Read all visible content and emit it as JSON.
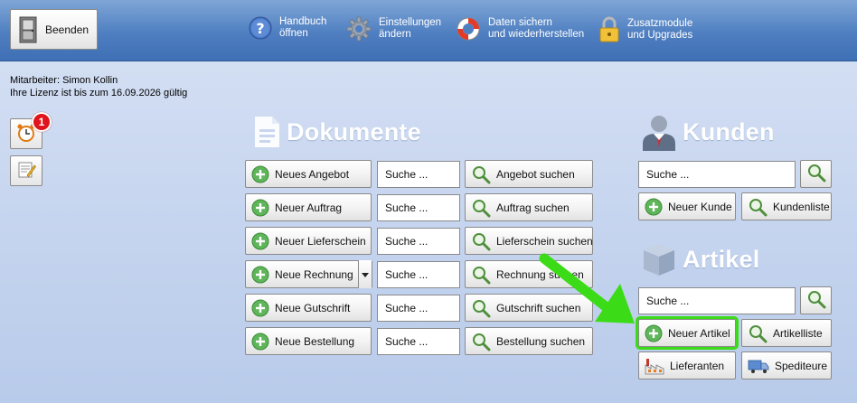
{
  "toolbar": {
    "quit_label": "Beenden",
    "items": [
      {
        "line1": "Handbuch",
        "line2": "öffnen",
        "icon": "help-icon"
      },
      {
        "line1": "Einstellungen",
        "line2": "ändern",
        "icon": "gear-icon"
      },
      {
        "line1": "Daten sichern",
        "line2": "und wiederherstellen",
        "icon": "lifebuoy-icon"
      },
      {
        "line1": "Zusatzmodule",
        "line2": "und Upgrades",
        "icon": "lock-icon"
      }
    ]
  },
  "info": {
    "employee": "Mitarbeiter: Simon Kollin",
    "license": "Ihre Lizenz ist bis zum 16.09.2026 gültig"
  },
  "side": {
    "reminder_count": "1"
  },
  "dokumente": {
    "title": "Dokumente",
    "rows": [
      {
        "new_label": "Neues Angebot",
        "search_value": "Suche ...",
        "search_label": "Angebot suchen"
      },
      {
        "new_label": "Neuer Auftrag",
        "search_value": "Suche ...",
        "search_label": "Auftrag suchen"
      },
      {
        "new_label": "Neuer Lieferschein",
        "search_value": "Suche ...",
        "search_label": "Lieferschein suchen"
      },
      {
        "new_label": "Neue Rechnung",
        "search_value": "Suche ...",
        "search_label": "Rechnung suchen"
      },
      {
        "new_label": "Neue Gutschrift",
        "search_value": "Suche ...",
        "search_label": "Gutschrift suchen"
      },
      {
        "new_label": "Neue Bestellung",
        "search_value": "Suche ...",
        "search_label": "Bestellung suchen"
      }
    ]
  },
  "kunden": {
    "title": "Kunden",
    "search_value": "Suche ...",
    "new_label": "Neuer Kunde",
    "list_label": "Kundenliste"
  },
  "artikel": {
    "title": "Artikel",
    "search_value": "Suche ...",
    "new_label": "Neuer Artikel",
    "list_label": "Artikelliste",
    "suppliers_label": "Lieferanten",
    "shipping_label": "Spediteure"
  },
  "colors": {
    "accent": "#4f7fc1",
    "highlight": "#3bdc17",
    "badge": "#e0141c"
  }
}
